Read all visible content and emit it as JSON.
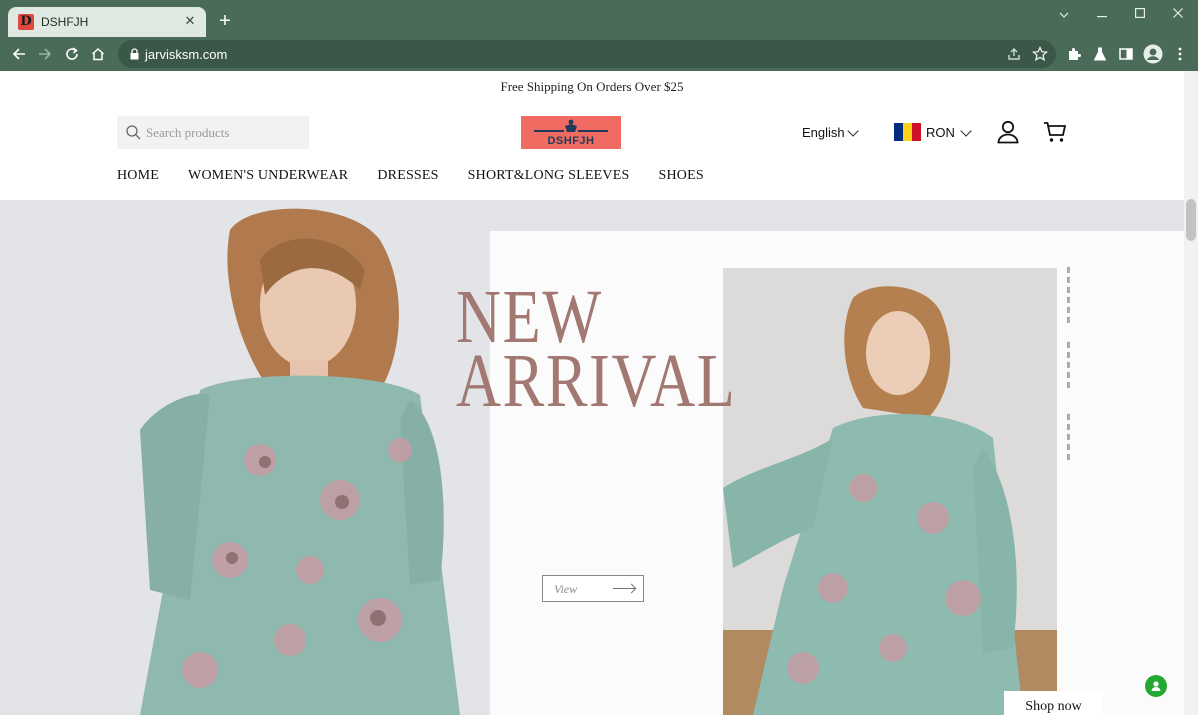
{
  "browser": {
    "tab_title": "DSHFJH",
    "tab_favicon_letter": "D",
    "url": "jarvisksm.com",
    "chrome_color": "#4a6b57"
  },
  "store": {
    "announcement": "Free Shipping On Orders Over $25",
    "search_placeholder": "Search products",
    "logo_text": "DSHFJH",
    "language": "English",
    "currency": "RON",
    "nav": [
      "HOME",
      "WOMEN'S UNDERWEAR",
      "DRESSES",
      "SHORT&LONG SLEEVES",
      "SHOES"
    ],
    "accent_color": "#f06b62"
  },
  "hero": {
    "title_line1": "NEW",
    "title_line2": "ARRIVAL",
    "view_label": "View",
    "shop_now_label": "Shop now",
    "title_color": "#a27872"
  },
  "icons": {
    "chat": "chat-icon"
  }
}
